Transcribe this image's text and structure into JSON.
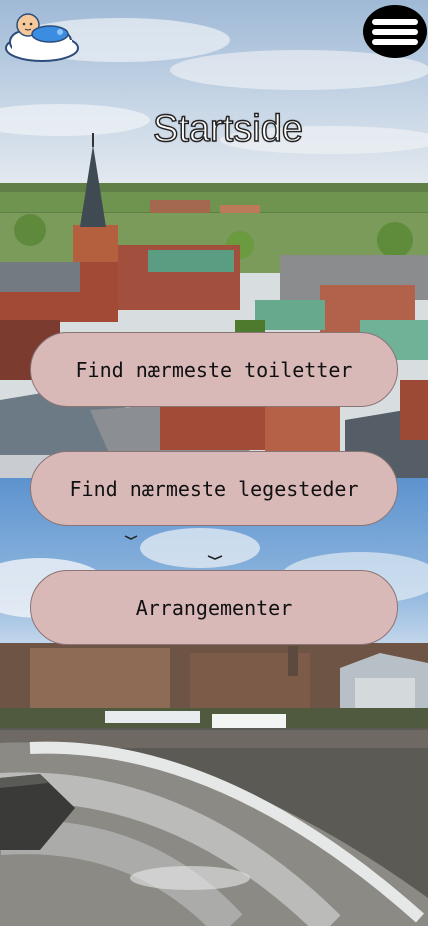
{
  "header": {
    "logo_icon": "baby-on-cloud-icon",
    "menu_icon": "hamburger-menu-icon"
  },
  "page": {
    "title": "Startside"
  },
  "buttons": {
    "toilets": "Find nærmeste toiletter",
    "playgrounds": "Find nærmeste legesteder",
    "events": "Arrangementer"
  },
  "colors": {
    "button_background": "#d9b8b8",
    "menu_background": "#000000",
    "title_text": "#ffffff"
  }
}
